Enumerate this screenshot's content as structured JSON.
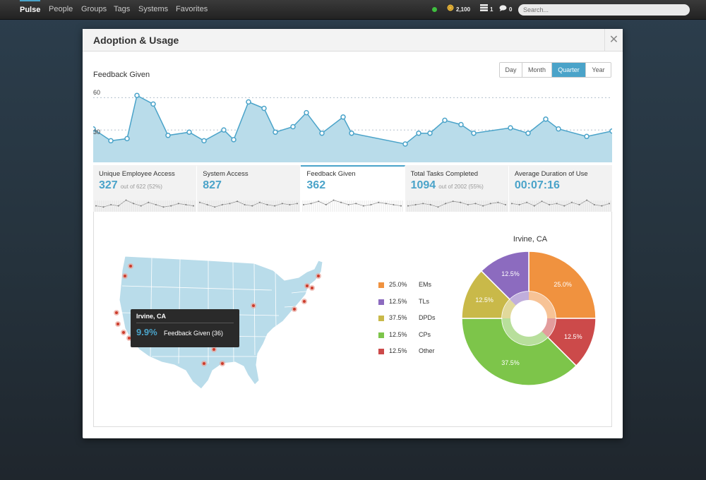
{
  "nav": {
    "items": [
      {
        "label": "Pulse",
        "active": true
      },
      {
        "label": "People",
        "active": false
      },
      {
        "label": "Groups",
        "active": false
      },
      {
        "label": "Tags",
        "active": false
      },
      {
        "label": "Systems",
        "active": false
      },
      {
        "label": "Favorites",
        "active": false
      }
    ],
    "stats": [
      {
        "icon": "coin-icon",
        "value": "2,100"
      },
      {
        "icon": "stack-icon",
        "value": "1"
      },
      {
        "icon": "chat-bubble-icon",
        "value": "0"
      }
    ],
    "status_color": "#3fbf3f",
    "search_placeholder": "Search..."
  },
  "modal": {
    "title": "Adoption & Usage",
    "close": "✕",
    "chart_title": "Feedback Given",
    "range_buttons": [
      {
        "label": "Day",
        "active": false
      },
      {
        "label": "Month",
        "active": false
      },
      {
        "label": "Quarter",
        "active": true
      },
      {
        "label": "Year",
        "active": false
      }
    ]
  },
  "chart_data": [
    {
      "type": "area",
      "title": "Feedback Given",
      "yticks": [
        30,
        60
      ],
      "ylim": [
        0,
        68
      ],
      "series": [
        {
          "values": [
            31,
            20,
            22,
            62,
            54,
            25,
            28,
            20,
            30,
            21,
            56,
            50,
            28,
            33,
            46,
            27,
            42,
            27,
            17,
            27,
            27,
            39,
            35,
            27,
            32,
            27,
            40,
            31,
            24,
            29
          ]
        }
      ],
      "x_positions": [
        0,
        25,
        48,
        62,
        85,
        106,
        136,
        157,
        185,
        199,
        220,
        242,
        258,
        283,
        302,
        324,
        354,
        366,
        442,
        461,
        477,
        498,
        521,
        539,
        591,
        616,
        641,
        659,
        699,
        735
      ]
    },
    {
      "type": "pie",
      "title": "Irvine, CA",
      "slices": [
        {
          "label": "EMs",
          "value": 25.0,
          "color": "#f0923f"
        },
        {
          "label": "Other",
          "value": 12.5,
          "color": "#cc4a4a"
        },
        {
          "label": "CPs",
          "value": 37.5,
          "color": "#7dc54a"
        },
        {
          "label": "DPDs",
          "value": 12.5,
          "color": "#c9b949"
        },
        {
          "label": "TLs",
          "value": 12.5,
          "color": "#8c6bbf"
        }
      ]
    }
  ],
  "tiles": [
    {
      "label": "Unique Employee Access",
      "value": "327",
      "sub": "out of 622 (52%)",
      "active": false
    },
    {
      "label": "System Access",
      "value": "827",
      "sub": "",
      "active": false
    },
    {
      "label": "Feedback Given",
      "value": "362",
      "sub": "",
      "active": true
    },
    {
      "label": "Total Tasks Completed",
      "value": "1094",
      "sub": "out of 2002 (55%)",
      "active": false
    },
    {
      "label": "Average Duration of Use",
      "value": "00:07:16",
      "sub": "",
      "active": false
    }
  ],
  "map": {
    "tooltip": {
      "title": "Irvine, CA",
      "pct": "9.9%",
      "text": "Feedback Given (36)"
    }
  },
  "legend": [
    {
      "pct": "25.0%",
      "label": "EMs",
      "color": "#f0923f"
    },
    {
      "pct": "12.5%",
      "label": "TLs",
      "color": "#8c6bbf"
    },
    {
      "pct": "37.5%",
      "label": "DPDs",
      "color": "#c9b949"
    },
    {
      "pct": "12.5%",
      "label": "CPs",
      "color": "#7dc54a"
    },
    {
      "pct": "12.5%",
      "label": "Other",
      "color": "#cc4a4a"
    }
  ],
  "colors": {
    "accent": "#4aa3c9",
    "area_fill": "#b9dcea"
  }
}
